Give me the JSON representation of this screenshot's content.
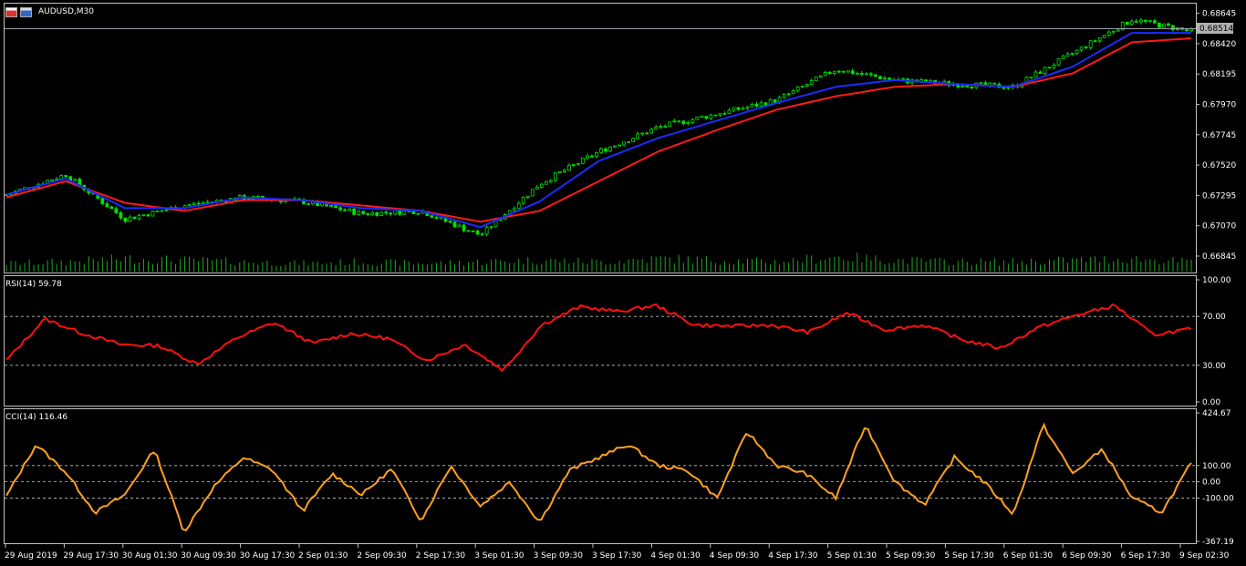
{
  "window": {
    "title": "AUDUSD,M30",
    "current_price": "0.68514"
  },
  "colors": {
    "background": "#000000",
    "candle_up": "#00e000",
    "candle_down": "#00e000",
    "volume": "#1faa1f",
    "ma_fast": "#1a2cff",
    "ma_slow": "#ff1a1a",
    "rsi": "#ff1010",
    "cci": "#ffa020",
    "grid_dashed": "#c0c0c0"
  },
  "price_axis": {
    "ticks": [
      "0.68645",
      "0.68420",
      "0.68195",
      "0.67970",
      "0.67745",
      "0.67520",
      "0.67295",
      "0.67070",
      "0.66845"
    ]
  },
  "rsi": {
    "label": "RSI(14) 59.78",
    "ticks": [
      "100.00",
      "70.00",
      "30.00",
      "0.00"
    ]
  },
  "cci": {
    "label": "CCI(14) 116.46",
    "ticks": [
      "424.67",
      "100.00",
      "0.00",
      "-100.00",
      "-367.19"
    ]
  },
  "time_axis": {
    "labels": [
      "29 Aug 2019",
      "29 Aug 17:30",
      "30 Aug 01:30",
      "30 Aug 09:30",
      "30 Aug 17:30",
      "2 Sep 01:30",
      "2 Sep 09:30",
      "2 Sep 17:30",
      "3 Sep 01:30",
      "3 Sep 09:30",
      "3 Sep 17:30",
      "4 Sep 01:30",
      "4 Sep 09:30",
      "4 Sep 17:30",
      "5 Sep 01:30",
      "5 Sep 09:30",
      "5 Sep 17:30",
      "6 Sep 01:30",
      "6 Sep 09:30",
      "6 Sep 17:30",
      "9 Sep 02:30"
    ]
  },
  "chart_data": [
    {
      "type": "candlestick",
      "title": "AUDUSD,M30",
      "ylim": [
        0.6673,
        0.6871
      ],
      "x": [
        "29 Aug 2019",
        "29 Aug 17:30",
        "30 Aug 01:30",
        "30 Aug 09:30",
        "30 Aug 17:30",
        "2 Sep 01:30",
        "2 Sep 09:30",
        "2 Sep 17:30",
        "3 Sep 01:30",
        "3 Sep 09:30",
        "3 Sep 17:30",
        "4 Sep 01:30",
        "4 Sep 09:30",
        "4 Sep 17:30",
        "5 Sep 01:30",
        "5 Sep 09:30",
        "5 Sep 17:30",
        "6 Sep 01:30",
        "6 Sep 09:30",
        "6 Sep 17:30",
        "9 Sep 02:30"
      ],
      "close_approx": [
        0.673,
        0.6745,
        0.6712,
        0.6722,
        0.6728,
        0.6725,
        0.6716,
        0.6718,
        0.67,
        0.6738,
        0.6762,
        0.678,
        0.679,
        0.68,
        0.6823,
        0.6815,
        0.6812,
        0.681,
        0.6835,
        0.686,
        0.6851
      ],
      "ma_fast_approx": [
        0.673,
        0.6742,
        0.672,
        0.672,
        0.6728,
        0.6726,
        0.672,
        0.6718,
        0.6706,
        0.6725,
        0.6755,
        0.6772,
        0.6785,
        0.6798,
        0.681,
        0.6815,
        0.6812,
        0.681,
        0.6825,
        0.685,
        0.685
      ],
      "ma_slow_approx": [
        0.6728,
        0.674,
        0.6724,
        0.6718,
        0.6726,
        0.6726,
        0.6722,
        0.6718,
        0.671,
        0.6718,
        0.674,
        0.6762,
        0.6778,
        0.6793,
        0.6803,
        0.681,
        0.6812,
        0.681,
        0.682,
        0.6843,
        0.6846
      ],
      "volume_rel": [
        0.5,
        0.6,
        0.8,
        0.7,
        0.6,
        0.5,
        0.6,
        0.5,
        0.6,
        0.7,
        0.6,
        0.8,
        0.7,
        0.6,
        0.9,
        0.7,
        0.6,
        0.6,
        0.7,
        0.8,
        0.6
      ]
    },
    {
      "type": "line",
      "title": "RSI(14) 59.78",
      "ylim": [
        0,
        100
      ],
      "levels": [
        30,
        70
      ],
      "values": [
        34,
        68,
        56,
        47,
        46,
        31,
        52,
        65,
        48,
        56,
        52,
        34,
        47,
        26,
        63,
        78,
        74,
        79,
        63,
        62,
        63,
        57,
        73,
        59,
        63,
        51,
        44,
        61,
        71,
        79,
        55,
        59.78
      ]
    },
    {
      "type": "line",
      "title": "CCI(14) 116.46",
      "ylim": [
        -367.19,
        424.67
      ],
      "levels": [
        100,
        0,
        -100
      ],
      "values": [
        -90,
        230,
        60,
        -190,
        -80,
        200,
        -310,
        -30,
        150,
        70,
        -180,
        50,
        -80,
        80,
        -240,
        100,
        -150,
        0,
        -250,
        70,
        150,
        230,
        100,
        70,
        -100,
        310,
        100,
        50,
        -100,
        350,
        0,
        -140,
        150,
        0,
        -200,
        350,
        50,
        200,
        -100,
        -190,
        116.46
      ]
    }
  ]
}
